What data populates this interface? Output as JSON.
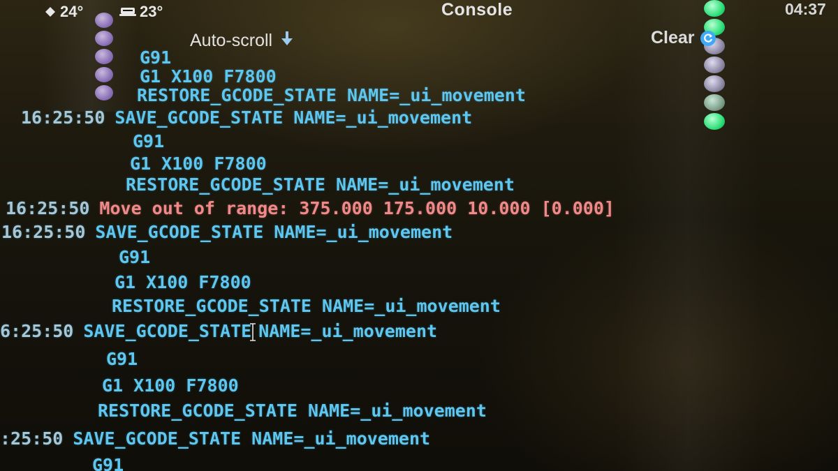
{
  "header": {
    "extruder_temp": "24°",
    "bed_temp": "23°",
    "title": "Console",
    "time": "04:37"
  },
  "controls": {
    "autoscroll_label": "Auto-scroll",
    "clear_label": "Clear"
  },
  "log": {
    "lines": [
      {
        "ts": "",
        "text": "G91"
      },
      {
        "ts": "",
        "text": "G1 X100 F7800"
      },
      {
        "ts": "",
        "text": "RESTORE_GCODE_STATE NAME=_ui_movement"
      },
      {
        "ts": "16:25:50",
        "text": "SAVE_GCODE_STATE NAME=_ui_movement"
      },
      {
        "ts": "",
        "text": "G91"
      },
      {
        "ts": "",
        "text": "G1 X100 F7800"
      },
      {
        "ts": "",
        "text": "RESTORE_GCODE_STATE NAME=_ui_movement"
      },
      {
        "ts": "16:25:50",
        "text": "Move out of range: 375.000 175.000 10.000 [0.000]",
        "error": true
      },
      {
        "ts": "16:25:50",
        "text": "SAVE_GCODE_STATE NAME=_ui_movement"
      },
      {
        "ts": "",
        "text": "G91"
      },
      {
        "ts": "",
        "text": "G1 X100 F7800"
      },
      {
        "ts": "",
        "text": "RESTORE_GCODE_STATE NAME=_ui_movement"
      },
      {
        "ts": "6:25:50",
        "text": "SAVE_GCODE_STATE",
        "text2": "NAME=_ui_movement"
      },
      {
        "ts": "",
        "text": "G91"
      },
      {
        "ts": "",
        "text": "G1 X100 F7800"
      },
      {
        "ts": "",
        "text": "RESTORE_GCODE_STATE NAME=_ui_movement"
      },
      {
        "ts": ":25:50",
        "text": "SAVE_GCODE_STATE NAME=_ui_movement"
      },
      {
        "ts": "",
        "text": "G91"
      }
    ]
  },
  "colors": {
    "command": "#5fc6ef",
    "timestamp": "#a7c6d6",
    "error": "#f08a8a",
    "indicator_left": "#9d7fd3",
    "indicator_right_on": "#2fe07a",
    "indicator_right_off": "#8f8aa6"
  },
  "icons": {
    "extruder": "thermometer-icon",
    "bed": "heated-bed-icon",
    "autoscroll": "arrow-down-icon",
    "clear": "refresh-icon"
  }
}
